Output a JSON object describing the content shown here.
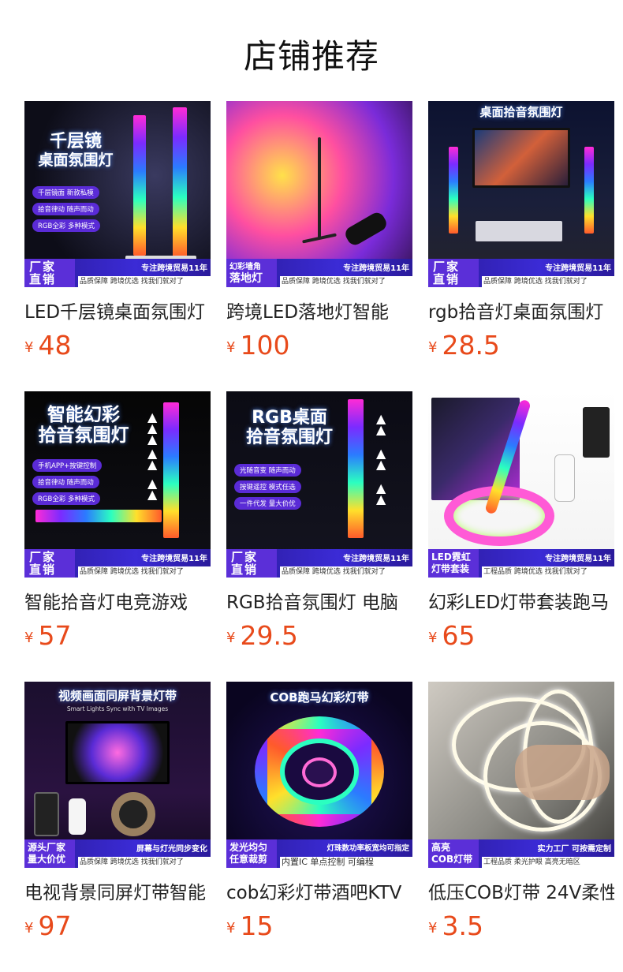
{
  "page": {
    "title": "店铺推荐"
  },
  "colors": {
    "price": "#e84a1b",
    "badge": "#5b2fd8",
    "bar": "#3b2bd6"
  },
  "products": [
    {
      "image_text": {
        "headline": [
          "千层镜",
          "桌面氛围灯"
        ],
        "pills": [
          "千层镜面 新款私模",
          "拾音律动 随声而动",
          "RGB全彩 多种模式"
        ],
        "badge": [
          "厂家",
          "直销"
        ],
        "slogan": "专注跨境贸易11年",
        "subline": "品质保障 跨境优选 找我们就对了"
      },
      "title": "LED千层镜桌面氛围灯",
      "currency": "¥",
      "price": "48"
    },
    {
      "image_text": {
        "headline": [],
        "pills": [],
        "badge": [
          "幻彩墙角",
          "落地灯"
        ],
        "slogan": "专注跨境贸易11年",
        "subline": "品质保障 跨境优选 找我们就对了"
      },
      "title": "跨境LED落地灯智能",
      "currency": "¥",
      "price": "100"
    },
    {
      "image_text": {
        "headline": [
          "桌面拾音氛围灯"
        ],
        "pills": [],
        "badge": [
          "厂家",
          "直销"
        ],
        "slogan": "专注跨境贸易11年",
        "subline": "品质保障 跨境优选 找我们就对了"
      },
      "title": "rgb拾音灯桌面氛围灯",
      "currency": "¥",
      "price": "28.5"
    },
    {
      "image_text": {
        "headline": [
          "智能幻彩",
          "拾音氛围灯"
        ],
        "pills": [
          "手机APP+按键控制",
          "拾音律动 随声而动",
          "RGB全彩 多种模式"
        ],
        "badge": [
          "厂家",
          "直销"
        ],
        "slogan": "专注跨境贸易11年",
        "subline": "品质保障 跨境优选 找我们就对了"
      },
      "title": "智能拾音灯电竞游戏",
      "currency": "¥",
      "price": "57"
    },
    {
      "image_text": {
        "headline": [
          "RGB桌面",
          "拾音氛围灯"
        ],
        "pills": [
          "光随音变 随声而动",
          "按键遥控 模式任选",
          "一件代发 量大价优"
        ],
        "badge": [
          "厂家",
          "直销"
        ],
        "slogan": "专注跨境贸易11年",
        "subline": "品质保障 跨境优选 找我们就对了"
      },
      "title": "RGB拾音氛围灯 电脑",
      "currency": "¥",
      "price": "29.5"
    },
    {
      "image_text": {
        "headline": [],
        "pills": [],
        "badge": [
          "LED霓虹",
          "灯带套装"
        ],
        "slogan": "专注跨境贸易11年",
        "subline": "工程品质 跨境优选 找我们就对了"
      },
      "title": "幻彩LED灯带套装跑马",
      "currency": "¥",
      "price": "65"
    },
    {
      "image_text": {
        "headline": [
          "视频画面同屏背景灯带"
        ],
        "subheadline": "Smart Lights Sync with TV Images",
        "pills": [],
        "badge": [
          "源头厂家",
          "量大价优"
        ],
        "slogan": "屏幕与灯光同步变化",
        "subline": "品质保障 跨境优选 找我们就对了"
      },
      "title": "电视背景同屏灯带智能",
      "currency": "¥",
      "price": "97"
    },
    {
      "image_text": {
        "headline": [
          "COB跑马幻彩灯带"
        ],
        "pills": [],
        "badge": [
          "发光均匀",
          "任意裁剪"
        ],
        "slogan": "灯珠数功率板宽均可指定",
        "subline": "内置IC 单点控制 可编程"
      },
      "title": "cob幻彩灯带酒吧KTV",
      "currency": "¥",
      "price": "15"
    },
    {
      "image_text": {
        "headline": [],
        "pills": [],
        "badge": [
          "高亮",
          "COB灯带"
        ],
        "slogan": "实力工厂 可按需定制",
        "subline": "工程品质 柔光护眼 高亮无暗区"
      },
      "title": "低压COB灯带 24V柔性",
      "currency": "¥",
      "price": "3.5"
    }
  ]
}
